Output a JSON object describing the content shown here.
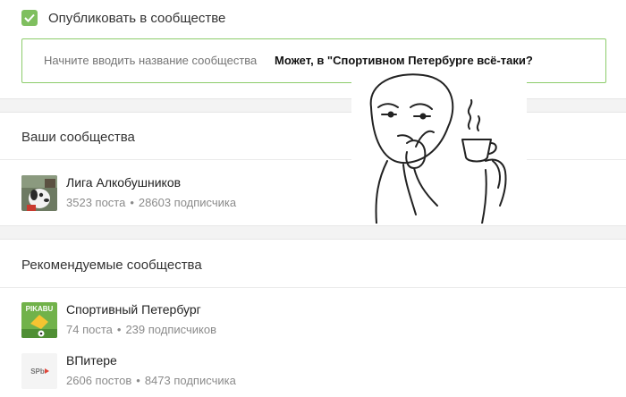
{
  "publish": {
    "checked": true,
    "label": "Опубликовать в сообществе"
  },
  "community_search": {
    "placeholder": "Начните вводить название сообщества"
  },
  "caption": "Может, в \"Спортивном Петербурге всё-таки?",
  "your_communities": {
    "title": "Ваши сообщества",
    "items": [
      {
        "name": "Лига Алкобушников",
        "posts": "3523 поста",
        "subscribers": "28603 подписчика",
        "avatar_icon": "dog-cartoon-avatar"
      }
    ]
  },
  "recommended": {
    "title": "Рекомендуемые сообщества",
    "items": [
      {
        "name": "Спортивный Петербург",
        "posts": "74 поста",
        "subscribers": "239 подписчиков",
        "avatar_icon": "pikabu-sport-logo",
        "avatar_text": "PIKABU"
      },
      {
        "name": "ВПитере",
        "posts": "2606 постов",
        "subscribers": "8473 подписчика",
        "avatar_icon": "spb-logo",
        "avatar_text": "SPb"
      }
    ]
  },
  "colors": {
    "accent_green": "#7fbf5f",
    "border_green": "#8ccc6b",
    "muted_text": "#8b8b8b"
  }
}
